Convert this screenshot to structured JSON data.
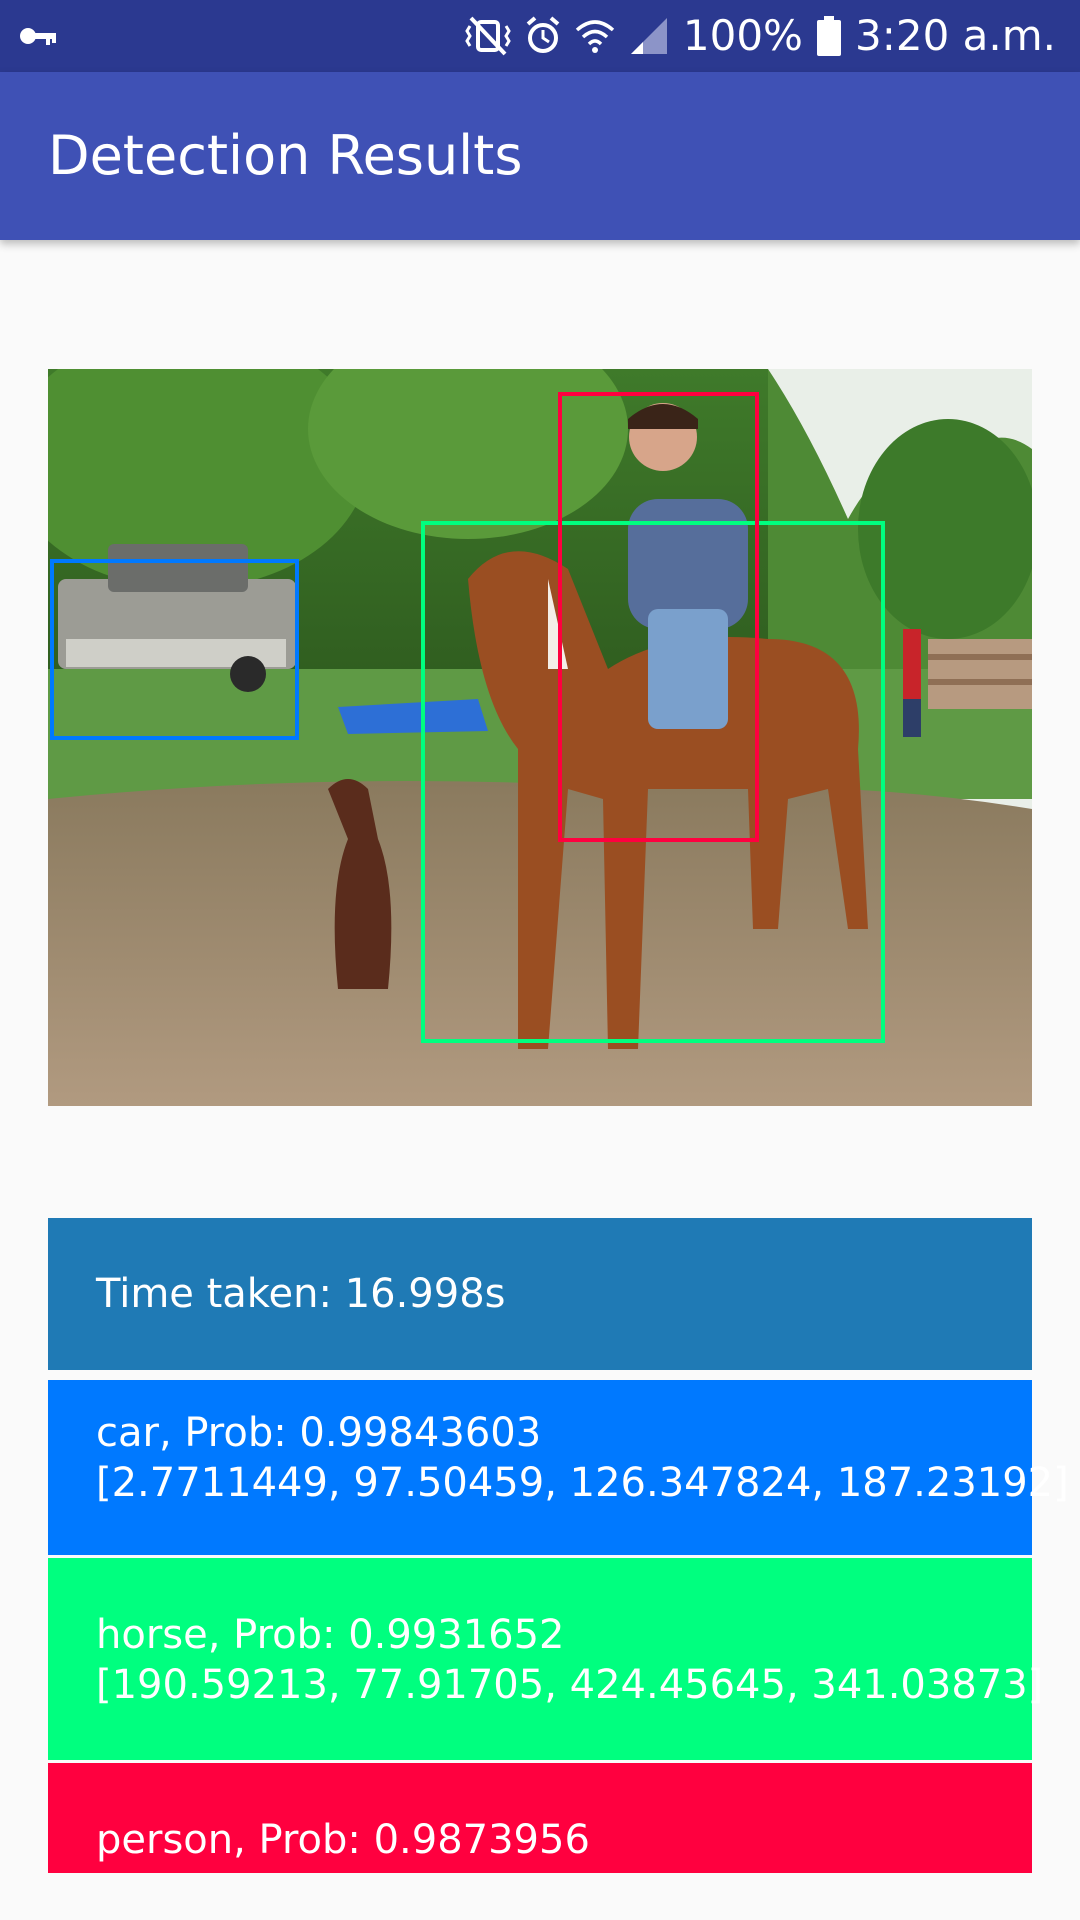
{
  "status_bar": {
    "icons": [
      "key-icon",
      "vibrate-icon",
      "alarm-icon",
      "wifi-icon",
      "signal-icon",
      "battery-icon"
    ],
    "battery": "100%",
    "time": "3:20 a.m."
  },
  "app_bar": {
    "title": "Detection Results"
  },
  "image": {
    "description_icon": "detection-photo"
  },
  "results": {
    "time_taken": "Time taken: 16.998s",
    "detections": [
      {
        "label": "car, Prob: 0.99843603",
        "box": "[2.7711449, 97.50459, 126.347824, 187.23192]",
        "color": "#0079ff"
      },
      {
        "label": "horse, Prob: 0.9931652",
        "box": "[190.59213, 77.91705, 424.45645, 341.03873]",
        "color": "#00ff7f"
      },
      {
        "label": "person, Prob: 0.9873956",
        "box": "",
        "color": "#ff003f"
      }
    ]
  },
  "colors": {
    "status_bar": "#2b3990",
    "app_bar": "#3f51b5",
    "time_box": "#1f7ab5",
    "background": "#fafafa"
  }
}
